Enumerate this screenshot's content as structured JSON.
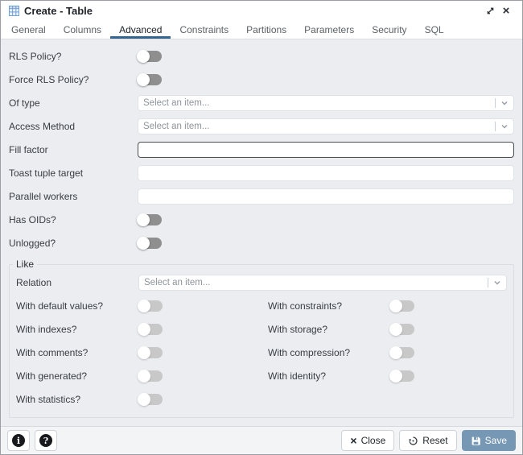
{
  "window": {
    "title": "Create - Table"
  },
  "tabs": {
    "items": [
      {
        "label": "General"
      },
      {
        "label": "Columns"
      },
      {
        "label": "Advanced"
      },
      {
        "label": "Constraints"
      },
      {
        "label": "Partitions"
      },
      {
        "label": "Parameters"
      },
      {
        "label": "Security"
      },
      {
        "label": "SQL"
      }
    ],
    "active": "Advanced"
  },
  "form": {
    "fields": {
      "rls_policy": {
        "label": "RLS Policy?",
        "value": "off"
      },
      "force_rls_policy": {
        "label": "Force RLS Policy?",
        "value": "off"
      },
      "of_type": {
        "label": "Of type",
        "placeholder": "Select an item..."
      },
      "access_method": {
        "label": "Access Method",
        "placeholder": "Select an item..."
      },
      "fill_factor": {
        "label": "Fill factor",
        "value": "",
        "focused": true
      },
      "toast_tuple_target": {
        "label": "Toast tuple target",
        "value": ""
      },
      "parallel_workers": {
        "label": "Parallel workers",
        "value": ""
      },
      "has_oids": {
        "label": "Has OIDs?",
        "value": "off"
      },
      "unlogged": {
        "label": "Unlogged?",
        "value": "off"
      }
    },
    "like_section": {
      "legend": "Like",
      "relation": {
        "label": "Relation",
        "placeholder": "Select an item..."
      },
      "toggles": [
        {
          "label": "With default values?",
          "value": "off",
          "disabled": true
        },
        {
          "label": "With constraints?",
          "value": "off",
          "disabled": true
        },
        {
          "label": "With indexes?",
          "value": "off",
          "disabled": true
        },
        {
          "label": "With storage?",
          "value": "off",
          "disabled": true
        },
        {
          "label": "With comments?",
          "value": "off",
          "disabled": true
        },
        {
          "label": "With compression?",
          "value": "off",
          "disabled": true
        },
        {
          "label": "With generated?",
          "value": "off",
          "disabled": true
        },
        {
          "label": "With identity?",
          "value": "off",
          "disabled": true
        },
        {
          "label": "With statistics?",
          "value": "off",
          "disabled": true
        }
      ]
    }
  },
  "footer": {
    "close_label": "Close",
    "reset_label": "Reset",
    "save_label": "Save"
  },
  "icons": {
    "info_glyph": "i",
    "help_glyph": "?",
    "window_close_glyph": "×",
    "close_button_glyph": "×"
  },
  "colors": {
    "accent": "#326690",
    "save_button_bg": "#7698b4",
    "toggle_off": "#8f8f8f",
    "toggle_off_disabled": "#c8c8c8",
    "content_bg": "#ebedf0"
  }
}
